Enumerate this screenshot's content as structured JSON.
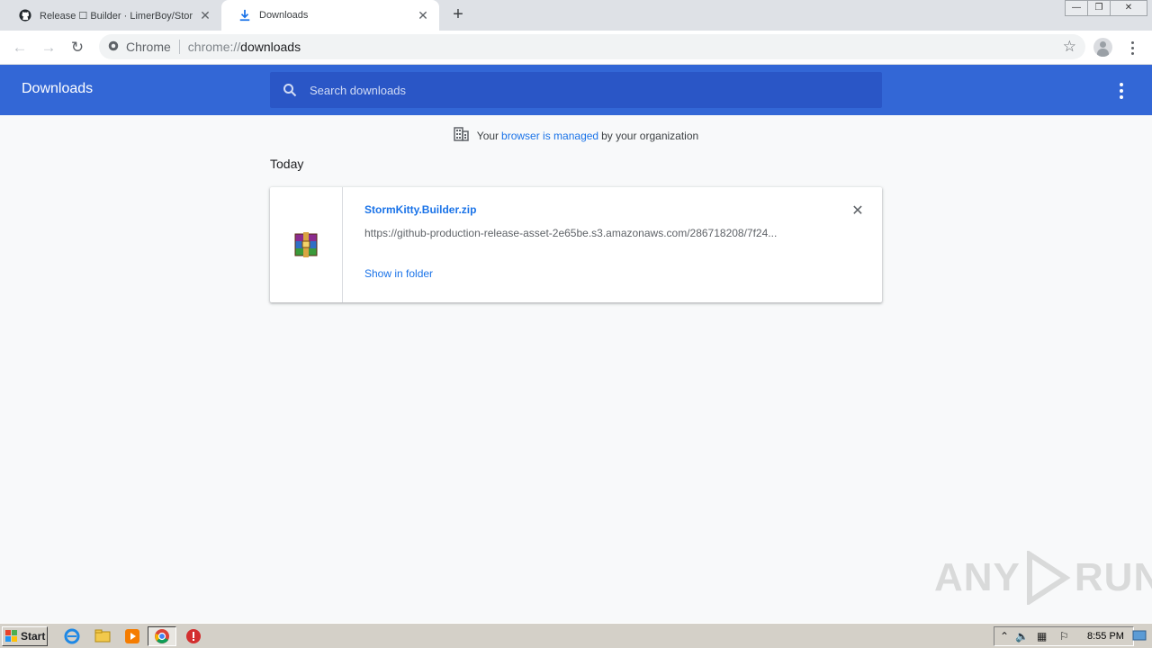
{
  "tabs": [
    {
      "title": "Release ☐ Builder · LimerBoy/StormKitty",
      "close": "✕"
    },
    {
      "title": "Downloads",
      "close": "✕"
    }
  ],
  "new_tab": "+",
  "window_controls": {
    "minimize": "—",
    "restore": "❐",
    "close": "✕"
  },
  "toolbar": {
    "back": "←",
    "forward": "→",
    "reload": "↻",
    "chip": "Chrome",
    "url_scheme": "chrome://",
    "url_host": "downloads",
    "bookmark": "☆"
  },
  "header": {
    "title": "Downloads",
    "search_placeholder": "Search downloads"
  },
  "managed": {
    "prefix": "Your",
    "link": "browser is managed",
    "suffix": "by your organization"
  },
  "section": {
    "today": "Today"
  },
  "download": {
    "file_name": "StormKitty.Builder.zip",
    "url": "https://github-production-release-asset-2e65be.s3.amazonaws.com/286718208/7f24...",
    "action": "Show in folder",
    "remove": "✕"
  },
  "watermark": {
    "left": "ANY",
    "right": "RUN"
  },
  "taskbar": {
    "start": "Start",
    "clock": "8:55 PM"
  },
  "colors": {
    "header_bg": "#3367d6",
    "search_bg": "#2a56c6",
    "link": "#1a73e8",
    "page_bg": "#f8f9fa"
  }
}
